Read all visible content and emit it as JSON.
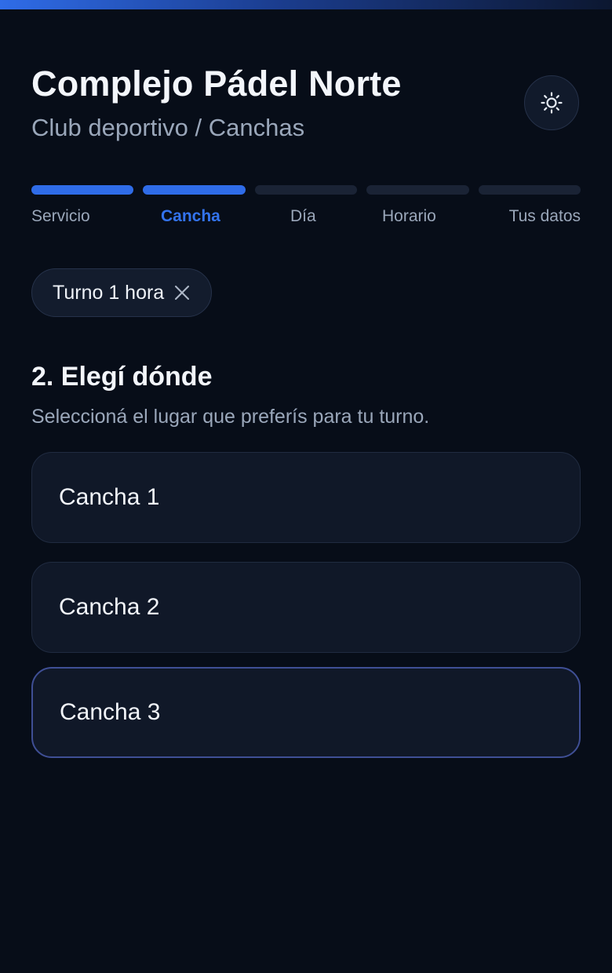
{
  "header": {
    "title": "Complejo Pádel Norte",
    "subtitle": "Club deportivo / Canchas",
    "theme_icon": "sun-icon"
  },
  "steps": {
    "current_index": 1,
    "items": [
      {
        "label": "Servicio",
        "done": true
      },
      {
        "label": "Cancha",
        "done": true
      },
      {
        "label": "Día",
        "done": false
      },
      {
        "label": "Horario",
        "done": false
      },
      {
        "label": "Tus datos",
        "done": false
      }
    ]
  },
  "selected_service_chip": {
    "label": "Turno 1 hora",
    "remove_icon": "close-icon"
  },
  "section": {
    "title": "2. Elegí dónde",
    "description": "Seleccioná el lugar que preferís para tu turno."
  },
  "courts": [
    {
      "name": "Cancha 1"
    },
    {
      "name": "Cancha 2"
    },
    {
      "name": "Cancha 3"
    }
  ],
  "colors": {
    "background": "#070d18",
    "accent": "#2f6ce8",
    "card": "#101828",
    "muted_text": "#9aa7ba"
  }
}
